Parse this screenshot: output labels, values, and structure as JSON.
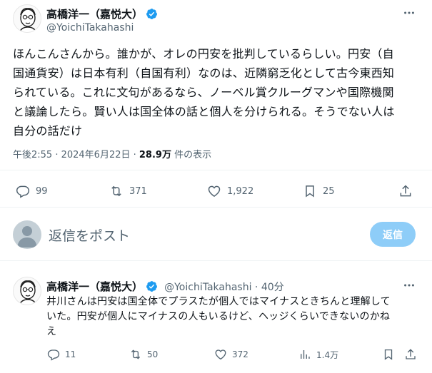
{
  "main_tweet": {
    "author_name": "高橋洋一（嘉悦大）",
    "handle": "@YoichiTakahashi",
    "text_lines": [
      "ほんこんさんから。誰かが、オレの円安を批判しているらしい。円安（自",
      "国通貨安）は日本有利（自国有利）なのは、近隣窮乏化として古今東西知",
      "られている。これに文句があるなら、ノーベル賞クルーグマンや国際機関",
      "と議論したら。賢い人は国全体の話と個人を分けられる。そうでない人は",
      "自分の話だけ"
    ],
    "time": "午後2:55 · 2024年6月22日 · ",
    "views_count": "28.9万",
    "views_label": " 件の表示",
    "stats": {
      "replies": "99",
      "reposts": "371",
      "likes": "1,922",
      "bookmarks": "25"
    }
  },
  "reply_composer": {
    "placeholder": "返信をポスト",
    "button_label": "返信"
  },
  "reply_tweet": {
    "author_name": "高橋洋一（嘉悦大）",
    "handle_time": "@YoichiTakahashi · 40分",
    "text_lines": [
      "井川さんは円安は国全体でプラスたが個人ではマイナスときちんと理解して",
      "いた。円安が個人にマイナスの人もいるけど、ヘッジくらいできないのかね",
      "え"
    ],
    "stats": {
      "replies": "11",
      "reposts": "50",
      "likes": "372",
      "views": "1.4万"
    }
  },
  "colors": {
    "verified_blue": "#1d9bf0",
    "reply_button_disabled": "#8ecdf8",
    "secondary_text": "#536471"
  }
}
